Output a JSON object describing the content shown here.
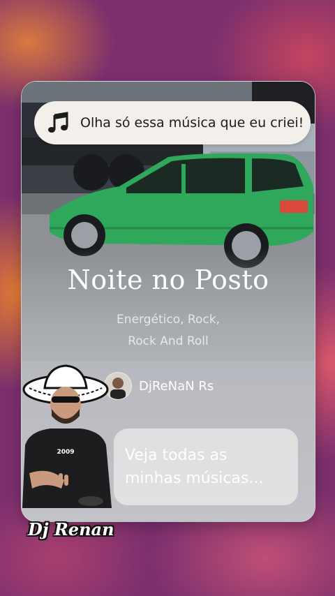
{
  "colors": {
    "background": "#7b2f6e",
    "card": "#a8acb2",
    "car": "#2fa85c",
    "bubble": "#f3efeb"
  },
  "prompt_bubble": {
    "icon": "music-note-icon",
    "text": "Olha só essa música que eu criei!"
  },
  "song": {
    "title": "Noite no Posto",
    "genres_line1": "Energético, Rock,",
    "genres_line2": "Rock And Roll"
  },
  "artist": {
    "name": "DjReNaN Rs"
  },
  "cta": {
    "line1": "Veja todas as",
    "line2": "minhas músicas..."
  },
  "overlay": {
    "signature": "Dj Renan"
  }
}
